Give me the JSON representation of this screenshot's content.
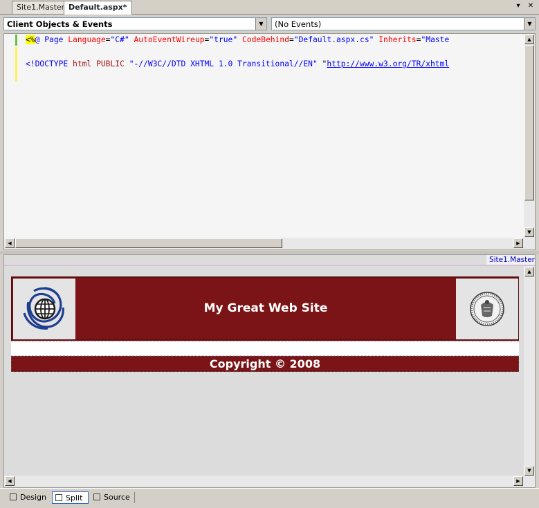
{
  "tabs": [
    {
      "label": "Site1.Master",
      "active": false
    },
    {
      "label": "Default.aspx*",
      "active": true
    }
  ],
  "tab_controls": {
    "dropdown_glyph": "▾",
    "close_glyph": "✕"
  },
  "dropdowns": {
    "objects": "Client Objects & Events",
    "events": "(No Events)"
  },
  "code": {
    "line1": {
      "open": "<%",
      "directive": "@ Page",
      "attr1": "Language",
      "val1": "\"C#\"",
      "attr2": "AutoEventWireup",
      "val2": "\"true\"",
      "attr3": "CodeBehind",
      "val3": "\"Default.aspx.cs\"",
      "attr4": "Inherits",
      "val4": "\"Maste"
    },
    "line3": {
      "open": "<!DOCTYPE",
      "name": "html",
      "public": "PUBLIC",
      "fpi": "\"-//W3C//DTD XHTML 1.0 Transitional//EN\"",
      "url": "http://www.w3.org/TR/xhtml"
    }
  },
  "design": {
    "master_label": "Site1.Master",
    "site_title": "My Great Web Site",
    "copyright": "Copyright © 2008"
  },
  "view_tabs": [
    {
      "label": "Design",
      "icon": "design-icon",
      "active": false
    },
    {
      "label": "Split",
      "icon": "split-icon",
      "active": true
    },
    {
      "label": "Source",
      "icon": "source-icon",
      "active": false
    }
  ],
  "colors": {
    "banner": "#7b1416",
    "accent": "#316ac5"
  }
}
